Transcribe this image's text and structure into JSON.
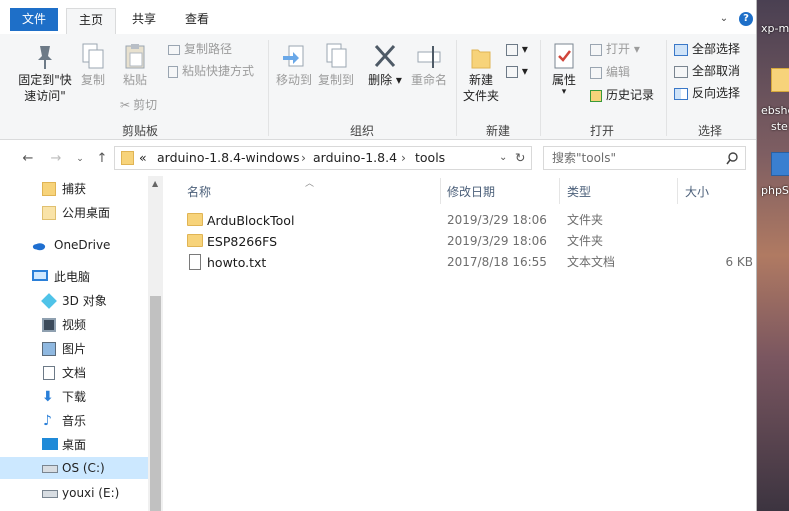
{
  "desktop": {
    "items": [
      "xp-m",
      "ebshe",
      "ste",
      "phpS"
    ]
  },
  "tabs": {
    "file": "文件",
    "home": "主页",
    "share": "共享",
    "view": "查看"
  },
  "ribbon": {
    "clipboard": {
      "label": "剪贴板",
      "pin_quick_access": "固定到\"快\n速访问\"",
      "copy": "复制",
      "paste": "粘贴",
      "copy_path": "复制路径",
      "paste_shortcut": "粘贴快捷方式",
      "cut": "剪切"
    },
    "organize": {
      "label": "组织",
      "move_to": "移动到",
      "copy_to": "复制到",
      "delete": "删除",
      "rename": "重命名"
    },
    "new": {
      "label": "新建",
      "new_folder": "新建\n文件夹"
    },
    "open": {
      "label": "打开",
      "properties": "属性",
      "open": "打开",
      "edit": "编辑",
      "history": "历史记录"
    },
    "select": {
      "label": "选择",
      "select_all": "全部选择",
      "select_none": "全部取消",
      "invert": "反向选择"
    }
  },
  "address": {
    "overflow": "«",
    "crumbs": [
      "arduino-1.8.4-windows",
      "arduino-1.8.4",
      "tools"
    ]
  },
  "search": {
    "placeholder": "搜索\"tools\""
  },
  "nav_pane": {
    "items": [
      {
        "label": "捕获",
        "icon": "folder-icon"
      },
      {
        "label": "公用桌面",
        "icon": "folder-icon"
      },
      {
        "label": "OneDrive",
        "icon": "cloud-icon"
      },
      {
        "label": "此电脑",
        "icon": "computer-icon"
      },
      {
        "label": "3D 对象",
        "icon": "cube-icon"
      },
      {
        "label": "视频",
        "icon": "video-icon"
      },
      {
        "label": "图片",
        "icon": "picture-icon"
      },
      {
        "label": "文档",
        "icon": "document-icon"
      },
      {
        "label": "下载",
        "icon": "download-icon"
      },
      {
        "label": "音乐",
        "icon": "music-icon"
      },
      {
        "label": "桌面",
        "icon": "desktop-icon"
      },
      {
        "label": "OS (C:)",
        "icon": "drive-icon",
        "selected": true
      },
      {
        "label": "youxi (E:)",
        "icon": "drive-icon"
      }
    ]
  },
  "file_list": {
    "columns": {
      "name": "名称",
      "date": "修改日期",
      "type": "类型",
      "size": "大小"
    },
    "rows": [
      {
        "name": "ArduBlockTool",
        "date": "2019/3/29 18:06",
        "type": "文件夹",
        "size": "",
        "icon": "folder-icon"
      },
      {
        "name": "ESP8266FS",
        "date": "2019/3/29 18:06",
        "type": "文件夹",
        "size": "",
        "icon": "folder-icon"
      },
      {
        "name": "howto.txt",
        "date": "2017/8/18 16:55",
        "type": "文本文档",
        "size": "6 KB",
        "icon": "text-file-icon"
      }
    ]
  },
  "colors": {
    "accent": "#1e6fc8",
    "selection": "#cce8ff",
    "header_text": "#4c607a"
  }
}
